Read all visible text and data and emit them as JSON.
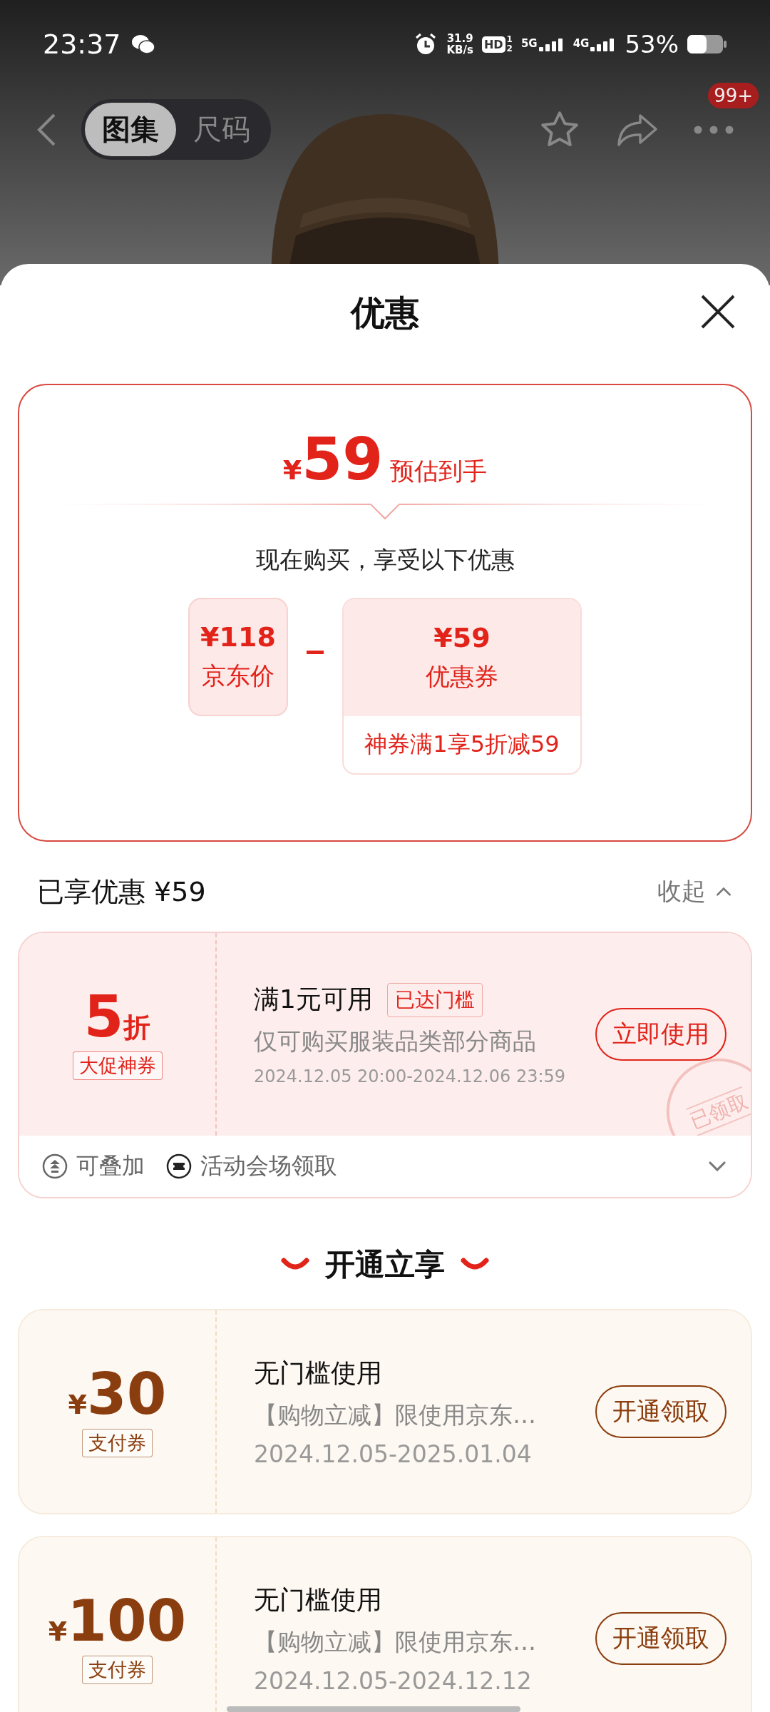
{
  "status_bar": {
    "time": "23:37",
    "net_speed": "31.9",
    "net_unit": "KB/s",
    "hd": "HD",
    "hd_slots": [
      "1",
      "2"
    ],
    "networks": [
      "5G",
      "4G"
    ],
    "battery": "53%"
  },
  "nav": {
    "tabs": [
      {
        "label": "图集",
        "selected": true
      },
      {
        "label": "尺码",
        "selected": false
      }
    ],
    "badge": "99+"
  },
  "sheet": {
    "title": "优惠"
  },
  "estimate": {
    "currency": "¥",
    "amount": "59",
    "label": "预估到手",
    "subtitle": "现在购买，享受以下优惠",
    "price": {
      "value": "¥118",
      "label": "京东价"
    },
    "coupon": {
      "value": "¥59",
      "label": "优惠券",
      "detail": "神券满1享5折减59"
    }
  },
  "savings": {
    "label": "已享优惠 ¥59",
    "toggle": "收起",
    "expanded": true
  },
  "claimed_coupons": [
    {
      "discount": "5",
      "unit": "折",
      "tag": "大促神券",
      "condition": "满1元可用",
      "condition_tag": "已达门槛",
      "scope": "仅可购买服装品类部分商品",
      "validity": "2024.12.05 20:00-2024.12.06 23:59",
      "action": "立即使用",
      "stamp": "已领取",
      "expanded": false,
      "features": [
        {
          "kind": "stack",
          "label": "可叠加"
        },
        {
          "kind": "ticket",
          "label": "活动会场领取"
        }
      ]
    }
  ],
  "member_section": {
    "title": "开通立享"
  },
  "member_coupons": [
    {
      "currency": "¥",
      "amount": "30",
      "tag": "支付券",
      "condition": "无门槛使用",
      "scope": "【购物立减】限使用京东…",
      "validity": "2024.12.05-2025.01.04",
      "action": "开通领取"
    },
    {
      "currency": "¥",
      "amount": "100",
      "tag": "支付券",
      "condition": "无门槛使用",
      "scope": "【购物立减】限使用京东…",
      "validity": "2024.12.05-2024.12.12",
      "action": "开通领取"
    }
  ]
}
